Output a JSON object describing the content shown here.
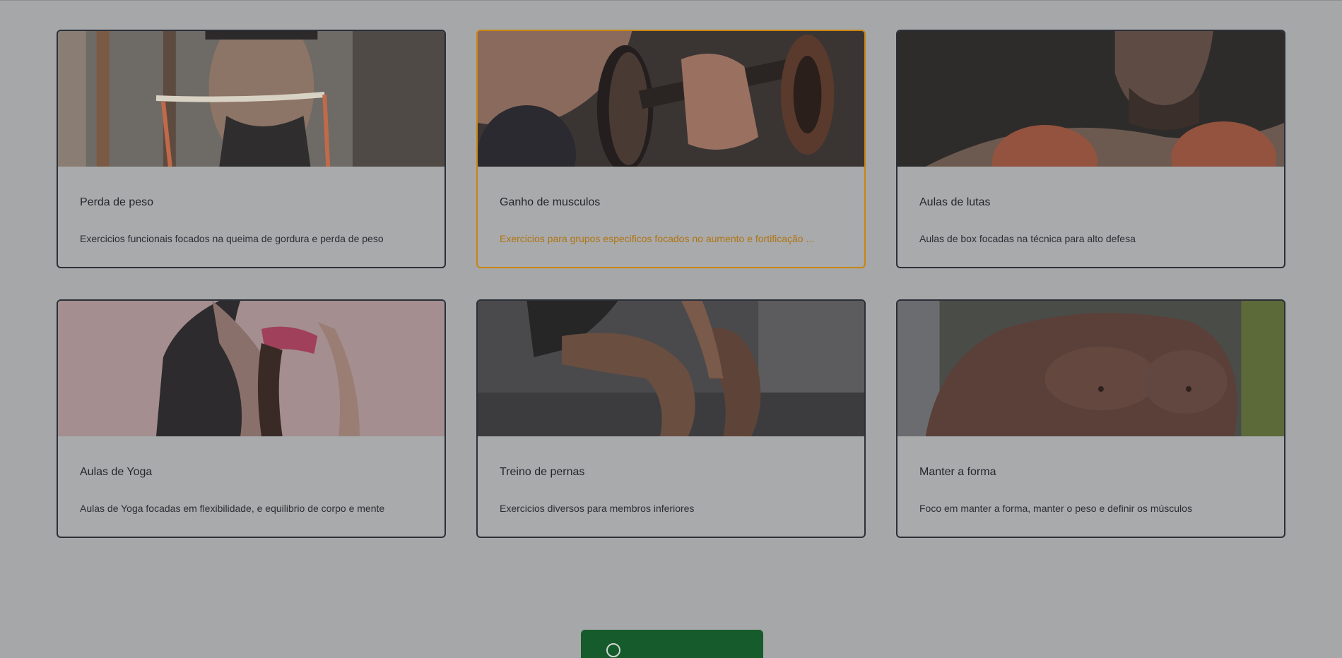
{
  "cards": [
    {
      "title": "Perda de peso",
      "description": "Exercicios funcionais focados na queima de gordura e perda de peso",
      "image": "waist-measuring-tape-photo"
    },
    {
      "title": "Ganho de musculos",
      "description": "Exercicios para grupos especificos focados no aumento e fortificação ...",
      "image": "dumbbell-lift-photo"
    },
    {
      "title": "Aulas de lutas",
      "description": "Aulas de box focadas na técnica para alto defesa",
      "image": "boxer-gloves-photo"
    },
    {
      "title": "Aulas de Yoga",
      "description": "Aulas de Yoga focadas em flexibilidade, e equilibrio de corpo e mente",
      "image": "yoga-backbend-photo"
    },
    {
      "title": "Treino de pernas",
      "description": "Exercicios diversos para membros inferiores",
      "image": "squat-legs-photo"
    },
    {
      "title": "Manter a forma",
      "description": "Foco em manter a forma, manter o peso e definir os músculos",
      "image": "athletic-torso-photo"
    }
  ],
  "active_card_index": 1,
  "colors": {
    "overlay_background": "#a6a7a8",
    "card_border": "#2b3038",
    "active_accent": "#c8850f",
    "cta_button": "#155b2c"
  },
  "cta": {
    "icon": "whatsapp-icon"
  }
}
